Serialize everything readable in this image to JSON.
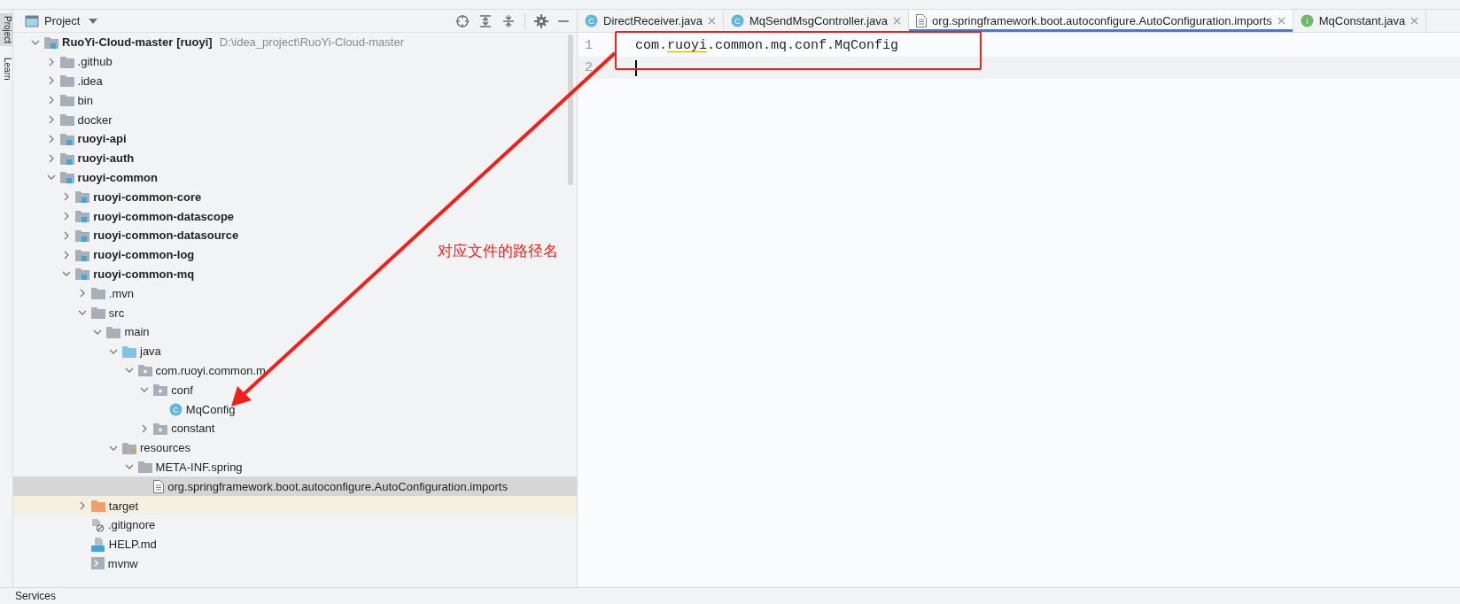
{
  "side_strip": {
    "tabs": [
      {
        "label": "Project",
        "selected": true
      },
      {
        "label": "Learn",
        "selected": false
      }
    ]
  },
  "project_panel": {
    "title": "Project",
    "tree": [
      {
        "name": "RuoYi-Cloud-master",
        "tag": "[ruoyi]",
        "path": "D:\\idea_project\\RuoYi-Cloud-master",
        "kind": "module",
        "expanded": true,
        "selected": false,
        "children": [
          {
            "name": ".github",
            "kind": "folder",
            "expanded": false,
            "selected": false
          },
          {
            "name": ".idea",
            "kind": "folder",
            "expanded": false,
            "selected": false
          },
          {
            "name": "bin",
            "kind": "folder",
            "expanded": false,
            "selected": false
          },
          {
            "name": "docker",
            "kind": "folder",
            "expanded": false,
            "selected": false
          },
          {
            "name": "ruoyi-api",
            "kind": "module",
            "expanded": false,
            "selected": false
          },
          {
            "name": "ruoyi-auth",
            "kind": "module",
            "expanded": false,
            "selected": false
          },
          {
            "name": "ruoyi-common",
            "kind": "module",
            "expanded": true,
            "selected": false,
            "children": [
              {
                "name": "ruoyi-common-core",
                "kind": "module",
                "expanded": false,
                "selected": false
              },
              {
                "name": "ruoyi-common-datascope",
                "kind": "module",
                "expanded": false,
                "selected": false
              },
              {
                "name": "ruoyi-common-datasource",
                "kind": "module",
                "expanded": false,
                "selected": false
              },
              {
                "name": "ruoyi-common-log",
                "kind": "module",
                "expanded": false,
                "selected": false
              },
              {
                "name": "ruoyi-common-mq",
                "kind": "module",
                "expanded": true,
                "selected": false,
                "children": [
                  {
                    "name": ".mvn",
                    "kind": "folder",
                    "expanded": false,
                    "selected": false
                  },
                  {
                    "name": "src",
                    "kind": "folder",
                    "expanded": true,
                    "selected": false,
                    "children": [
                      {
                        "name": "main",
                        "kind": "folder",
                        "expanded": true,
                        "selected": false,
                        "children": [
                          {
                            "name": "java",
                            "kind": "source",
                            "expanded": true,
                            "selected": false,
                            "children": [
                              {
                                "name": "com.ruoyi.common.m",
                                "kind": "package",
                                "expanded": true,
                                "selected": false,
                                "children": [
                                  {
                                    "name": "conf",
                                    "kind": "package",
                                    "expanded": true,
                                    "selected": false,
                                    "children": [
                                      {
                                        "name": "MqConfig",
                                        "kind": "class",
                                        "badge": "C",
                                        "selected": false
                                      }
                                    ]
                                  },
                                  {
                                    "name": "constant",
                                    "kind": "package",
                                    "expanded": false,
                                    "selected": false
                                  }
                                ]
                              }
                            ]
                          },
                          {
                            "name": "resources",
                            "kind": "resources",
                            "expanded": true,
                            "selected": false,
                            "children": [
                              {
                                "name": "META-INF.spring",
                                "kind": "folder",
                                "expanded": true,
                                "selected": false,
                                "children": [
                                  {
                                    "name": "org.springframework.boot.autoconfigure.AutoConfiguration.imports",
                                    "kind": "file",
                                    "selected": true
                                  }
                                ]
                              }
                            ]
                          }
                        ]
                      }
                    ]
                  },
                  {
                    "name": "target",
                    "kind": "excluded",
                    "expanded": false,
                    "selected": false
                  },
                  {
                    "name": ".gitignore",
                    "kind": "gitignore",
                    "selected": false
                  },
                  {
                    "name": "HELP.md",
                    "kind": "markdown",
                    "selected": false
                  },
                  {
                    "name": "mvnw",
                    "kind": "script",
                    "selected": false
                  }
                ]
              }
            ]
          }
        ]
      }
    ]
  },
  "editor": {
    "tabs": [
      {
        "label": "DirectReceiver.java",
        "kind": "class",
        "badge": "C",
        "selected": false
      },
      {
        "label": "MqSendMsgController.java",
        "kind": "class",
        "badge": "C",
        "selected": false
      },
      {
        "label": "org.springframework.boot.autoconfigure.AutoConfiguration.imports",
        "kind": "file",
        "selected": true
      },
      {
        "label": "MqConstant.java",
        "kind": "interface",
        "badge": "I",
        "selected": false
      }
    ],
    "lines": [
      {
        "number": "1",
        "current": false,
        "segments": [
          {
            "text": "com.",
            "typo": false
          },
          {
            "text": "ruoyi",
            "typo": true
          },
          {
            "text": ".common.mq.conf.MqConfig",
            "typo": false
          }
        ]
      },
      {
        "number": "2",
        "current": true
      }
    ]
  },
  "annotation": {
    "text": "对应文件的路径名"
  },
  "bottom_bar": {
    "label": "Services"
  }
}
